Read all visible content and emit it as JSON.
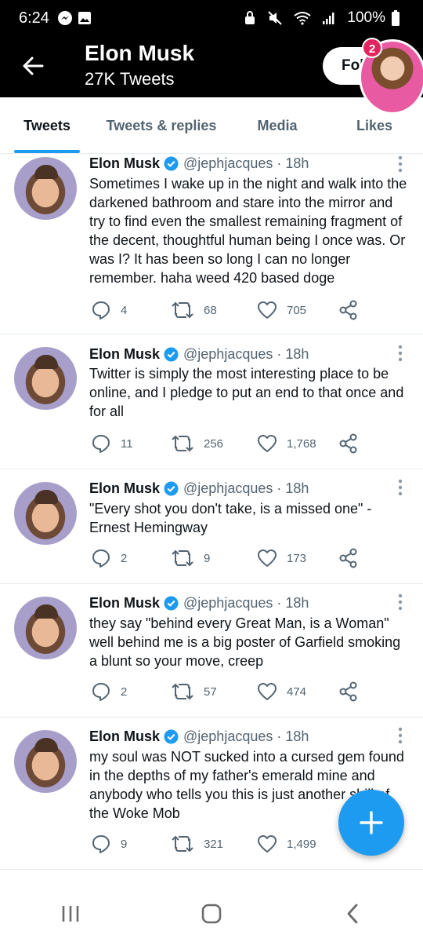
{
  "status_bar": {
    "time": "6:24",
    "battery": "100%"
  },
  "header": {
    "title": "Elon Musk",
    "subtitle": "27K Tweets",
    "follow_label": "Fol",
    "notification_count": "2"
  },
  "tabs": [
    {
      "label": "Tweets",
      "selected": true
    },
    {
      "label": "Tweets & replies",
      "selected": false
    },
    {
      "label": "Media",
      "selected": false
    },
    {
      "label": "Likes",
      "selected": false
    }
  ],
  "tweets": [
    {
      "name": "Elon Musk",
      "handle": "@jephjacques",
      "time": "· 18h",
      "text": "Sometimes I wake up in the night and walk into the darkened bathroom and stare into the mirror and try to find even the smallest remaining fragment of the decent, thoughtful human being I once was. Or was I? It has been so long I can no longer remember. haha weed 420 based doge",
      "replies": "4",
      "retweets": "68",
      "likes": "705"
    },
    {
      "name": "Elon Musk",
      "handle": "@jephjacques",
      "time": "· 18h",
      "text": "Twitter is simply the most interesting place to be online, and I pledge to put an end to that once and for all",
      "replies": "11",
      "retweets": "256",
      "likes": "1,768"
    },
    {
      "name": "Elon Musk",
      "handle": "@jephjacques",
      "time": "· 18h",
      "text": "\"Every shot you don't take, is a missed one\" -Ernest Hemingway",
      "replies": "2",
      "retweets": "9",
      "likes": "173"
    },
    {
      "name": "Elon Musk",
      "handle": "@jephjacques",
      "time": "· 18h",
      "text": "they say \"behind every Great Man, is a Woman\" well behind me is a big poster of Garfield smoking a blunt so your move, creep",
      "replies": "2",
      "retweets": "57",
      "likes": "474"
    },
    {
      "name": "Elon Musk",
      "handle": "@jephjacques",
      "time": "· 18h",
      "text": "my soul was NOT sucked into a cursed gem found in the depths of my father's emerald mine and anybody who tells you this is just another shill of the Woke Mob",
      "replies": "9",
      "retweets": "321",
      "likes": "1,499"
    }
  ],
  "colors": {
    "accent": "#1d9bf0",
    "header_bg": "#000000",
    "badge": "#e0245e",
    "muted": "#536471"
  },
  "icons": [
    "back-arrow-icon",
    "reply-icon",
    "retweet-icon",
    "like-icon",
    "share-icon",
    "verified-icon",
    "more-icon",
    "compose-icon",
    "recents-icon",
    "home-icon",
    "back-nav-icon"
  ]
}
